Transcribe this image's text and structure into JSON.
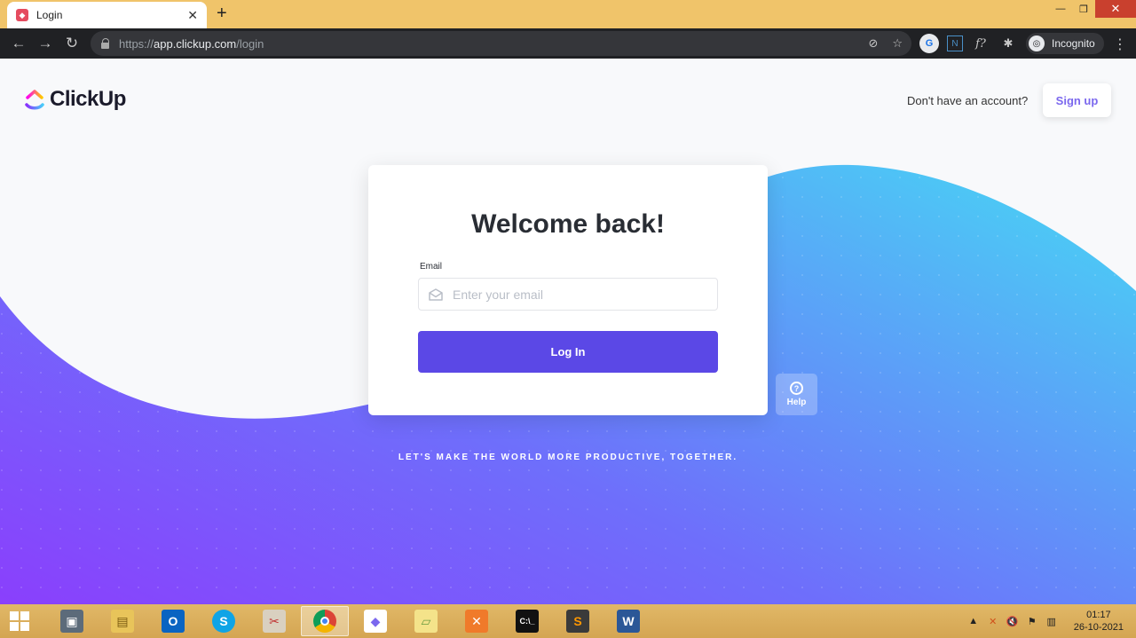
{
  "browser": {
    "tab_title": "Login",
    "url_scheme": "https://",
    "url_host": "app.clickup.com",
    "url_path": "/login",
    "incognito_label": "Incognito"
  },
  "header": {
    "brand": "ClickUp",
    "no_account_text": "Don't have an account?",
    "signup_label": "Sign up"
  },
  "login_card": {
    "title": "Welcome back!",
    "email_label": "Email",
    "email_placeholder": "Enter your email",
    "email_value": "",
    "login_label": "Log In"
  },
  "help": {
    "label": "Help",
    "glyph": "?"
  },
  "tagline": "LET'S MAKE THE WORLD MORE PRODUCTIVE, TOGETHER.",
  "taskbar": {
    "time": "01:17",
    "date": "26-10-2021"
  },
  "colors": {
    "accent": "#5b48e6",
    "brand_purple": "#7b68ee",
    "gradient_left": "#8a3ffc",
    "gradient_right": "#4cc9f5"
  }
}
